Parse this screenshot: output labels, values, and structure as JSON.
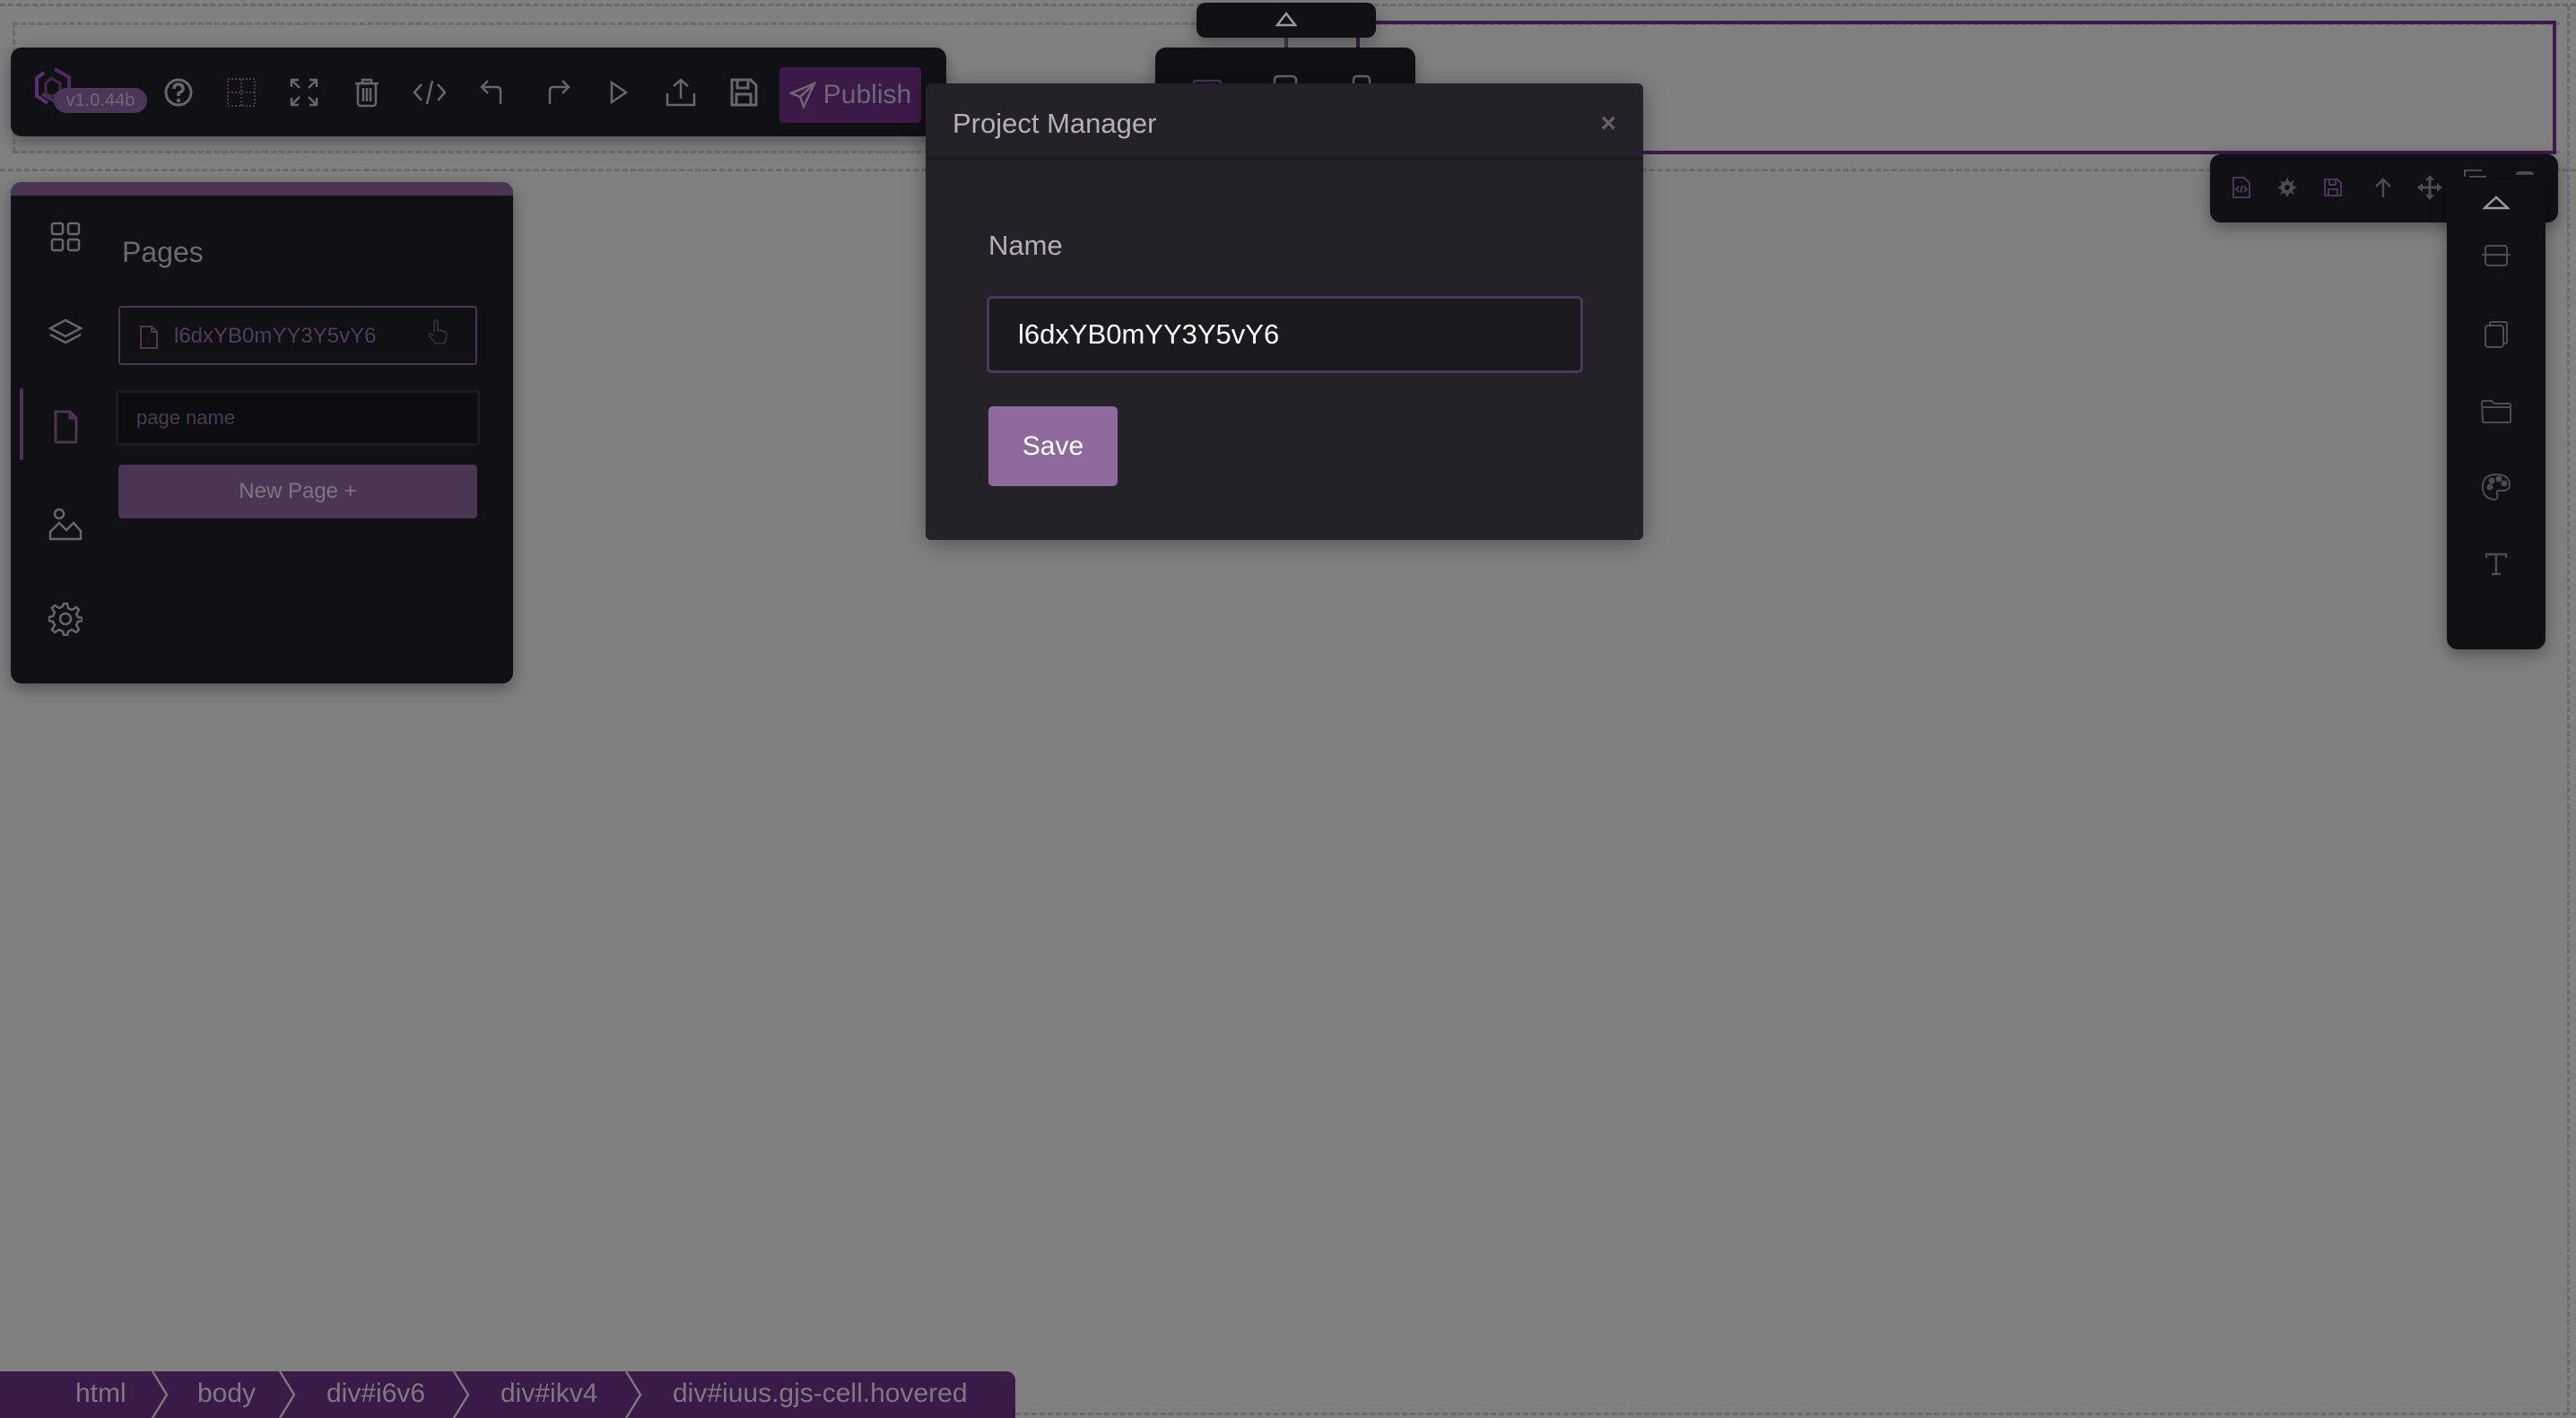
{
  "toolbar": {
    "version": "v1.0.44b",
    "publish_label": "Publish",
    "icons": [
      "logo-icon",
      "help-icon",
      "grid-icon",
      "fullscreen-icon",
      "trash-icon",
      "code-icon",
      "undo-icon",
      "redo-icon",
      "preview-icon",
      "export-icon",
      "save-icon",
      "send-icon"
    ]
  },
  "left_panel": {
    "title": "Pages",
    "sidebar_icons": [
      "blocks-icon",
      "layers-icon",
      "pages-icon",
      "assets-icon",
      "settings-icon"
    ],
    "active_item": "pages-icon",
    "pages": [
      {
        "name": "l6dxYB0mYY3Y5vY6"
      }
    ],
    "new_page_placeholder": "page name",
    "new_page_value": "",
    "new_page_button": "New Page +"
  },
  "modal": {
    "title": "Project Manager",
    "close_label": "×",
    "name_label": "Name",
    "name_value": "l6dxYB0mYY3Y5vY6",
    "save_label": "Save"
  },
  "component_toolbar": {
    "icons": [
      "code-file-icon",
      "gear-icon",
      "save-icon",
      "arrow-up-icon",
      "move-icon",
      "copy-icon",
      "delete-icon"
    ]
  },
  "right_sidebar": {
    "icons": [
      "collapse-up-icon",
      "section-icon",
      "duplicate-icon",
      "folder-icon",
      "palette-icon",
      "text-icon"
    ]
  },
  "breadcrumb": {
    "items": [
      "html",
      "body",
      "div#i6v6",
      "div#ikv4",
      "div#iuus.gjs-cell.hovered"
    ]
  },
  "colors": {
    "accent": "#3c1a48",
    "button": "#8e6b9c",
    "panel": "#111014",
    "modal": "#242228",
    "canvas_overlay": "#808080"
  }
}
